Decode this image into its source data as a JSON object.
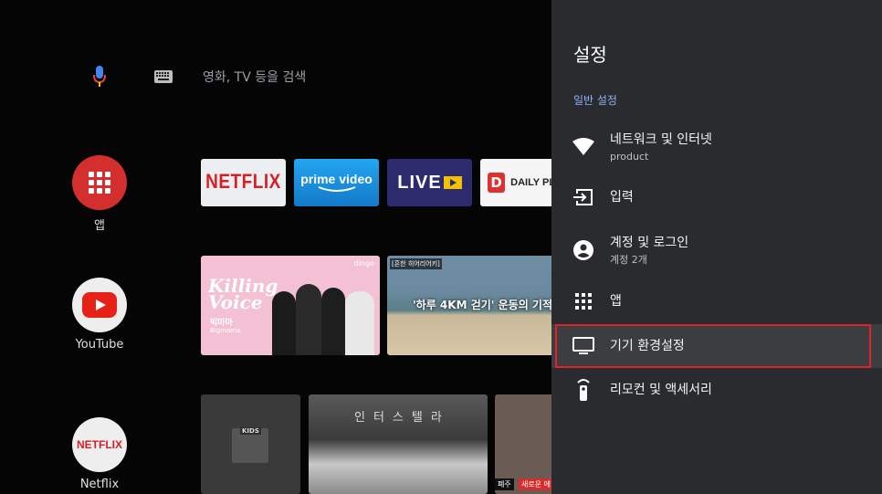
{
  "search": {
    "placeholder_text": "영화, TV 등을 검색"
  },
  "side_apps": [
    {
      "label": "앱",
      "icon": "apps-grid-icon",
      "color": "#d32f2f"
    },
    {
      "label": "YouTube",
      "icon": "youtube-logo-icon",
      "color": "#e62117"
    },
    {
      "label": "Netflix",
      "icon": "netflix-logo-icon",
      "color": "#d81f26"
    }
  ],
  "app_tiles": [
    {
      "name": "NETFLIX"
    },
    {
      "name": "prime video"
    },
    {
      "name": "LIVE"
    },
    {
      "name": "DAILY PLA"
    }
  ],
  "content_tiles": {
    "killing_voice": {
      "brand": "dingo",
      "title_line1": "Killing",
      "title_line2": "Voice",
      "artist": "빅마마",
      "artist_en": "Bigmama"
    },
    "beach": {
      "tag": "[흔한 히어리어키]",
      "caption": "'하루 4KM 걷기' 운동의 기적"
    },
    "kids": {
      "label": "KIDS"
    },
    "interstellar": {
      "title": "인터스텔라"
    },
    "show": {
      "badge1": "폐주",
      "badge2": "새로운 에"
    }
  },
  "settings": {
    "title": "설정",
    "section_label": "일반 설정",
    "items": [
      {
        "label": "네트워크 및 인터넷",
        "sub": "product",
        "icon": "wifi-icon"
      },
      {
        "label": "입력",
        "sub": "",
        "icon": "input-icon"
      },
      {
        "label": "계정 및 로그인",
        "sub": "계정 2개",
        "icon": "account-circle-icon"
      },
      {
        "label": "앱",
        "sub": "",
        "icon": "apps-grid-icon"
      },
      {
        "label": "기기 환경설정",
        "sub": "",
        "icon": "tv-icon"
      },
      {
        "label": "리모컨 및 액세서리",
        "sub": "",
        "icon": "remote-icon"
      }
    ],
    "selected_index": 4,
    "accent_color": "#8ab4f8",
    "highlight_color": "#e0222a"
  }
}
